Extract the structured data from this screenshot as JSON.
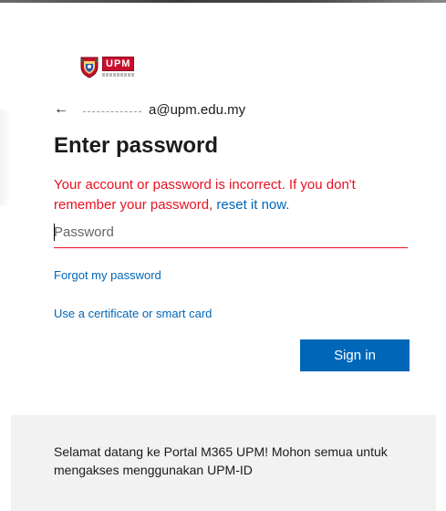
{
  "logo": {
    "text": "UPM",
    "accent_color": "#c8102e"
  },
  "identity": {
    "back_icon": "back-arrow-icon",
    "back_glyph": "←",
    "email_visible": "a@upm.edu.my"
  },
  "title": "Enter password",
  "error": {
    "message": "Your account or password is incorrect. If you don't remember your password,",
    "reset_link": "reset it now."
  },
  "password": {
    "placeholder": "Password",
    "value": ""
  },
  "links": {
    "forgot": "Forgot my password",
    "certificate": "Use a certificate or smart card"
  },
  "signin": {
    "label": "Sign in",
    "color": "#0067b8"
  },
  "footer": {
    "text": "Selamat datang ke Portal M365 UPM! Mohon semua untuk mengakses menggunakan UPM-ID"
  }
}
